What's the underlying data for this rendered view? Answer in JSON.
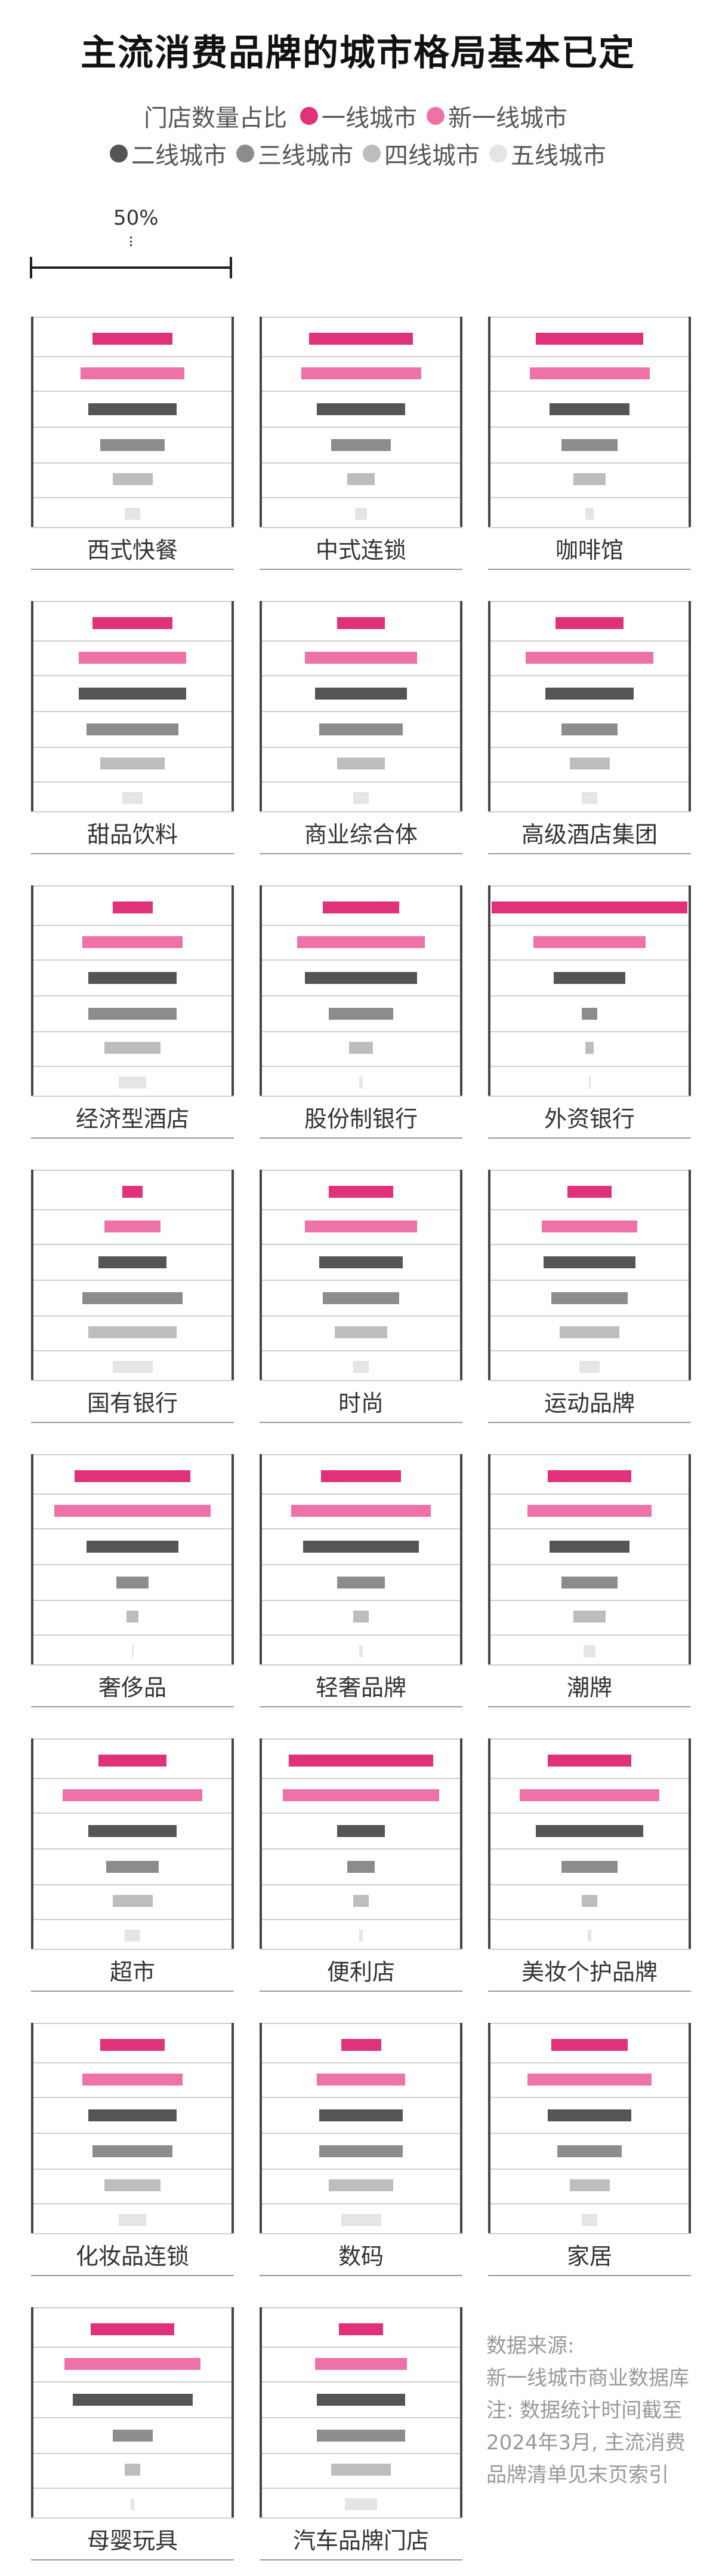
{
  "title": "主流消费品牌的城市格局基本已定",
  "legend": {
    "label": "门店数量占比",
    "tiers": [
      {
        "name": "一线城市",
        "color": "#e0317a"
      },
      {
        "name": "新一线城市",
        "color": "#ee72a8"
      },
      {
        "name": "二线城市",
        "color": "#555555"
      },
      {
        "name": "三线城市",
        "color": "#8c8c8c"
      },
      {
        "name": "四线城市",
        "color": "#bdbdbd"
      },
      {
        "name": "五线城市",
        "color": "#e5e5e5"
      }
    ]
  },
  "scale": {
    "label": "50%",
    "value": 50
  },
  "chart_data": {
    "type": "bar",
    "orientation": "horizontal",
    "unit": "%",
    "series_names": [
      "一线城市",
      "新一线城市",
      "二线城市",
      "三线城市",
      "四线城市",
      "五线城市"
    ],
    "panels": [
      {
        "name": "西式快餐",
        "values": [
          20,
          26,
          22,
          16,
          10,
          4
        ]
      },
      {
        "name": "中式连锁",
        "values": [
          26,
          30,
          22,
          15,
          7,
          3
        ]
      },
      {
        "name": "咖啡馆",
        "values": [
          27,
          30,
          20,
          14,
          8,
          2
        ]
      },
      {
        "name": "甜品饮料",
        "values": [
          20,
          27,
          27,
          23,
          16,
          5
        ]
      },
      {
        "name": "商业综合体",
        "values": [
          12,
          28,
          23,
          21,
          12,
          4
        ]
      },
      {
        "name": "高级酒店集团",
        "values": [
          17,
          32,
          22,
          14,
          10,
          4
        ]
      },
      {
        "name": "经济型酒店",
        "values": [
          10,
          25,
          22,
          22,
          14,
          7
        ]
      },
      {
        "name": "股份制银行",
        "values": [
          19,
          32,
          28,
          16,
          6,
          1
        ]
      },
      {
        "name": "外资银行",
        "values": [
          49,
          28,
          18,
          4,
          2,
          0
        ]
      },
      {
        "name": "国有银行",
        "values": [
          5,
          14,
          17,
          25,
          22,
          10
        ]
      },
      {
        "name": "时尚",
        "values": [
          16,
          28,
          21,
          19,
          13,
          4
        ]
      },
      {
        "name": "运动品牌",
        "values": [
          11,
          24,
          23,
          19,
          15,
          5
        ]
      },
      {
        "name": "奢侈品",
        "values": [
          29,
          39,
          23,
          8,
          3,
          0
        ]
      },
      {
        "name": "轻奢品牌",
        "values": [
          20,
          35,
          29,
          12,
          4,
          1
        ]
      },
      {
        "name": "潮牌",
        "values": [
          21,
          31,
          20,
          14,
          8,
          3
        ]
      },
      {
        "name": "超市",
        "values": [
          17,
          35,
          22,
          13,
          10,
          4
        ]
      },
      {
        "name": "便利店",
        "values": [
          36,
          39,
          12,
          7,
          4,
          1
        ]
      },
      {
        "name": "美妆个护品牌",
        "values": [
          21,
          35,
          27,
          14,
          4,
          1
        ]
      },
      {
        "name": "化妆品连锁",
        "values": [
          16,
          25,
          22,
          20,
          14,
          7
        ]
      },
      {
        "name": "数码",
        "values": [
          10,
          22,
          21,
          21,
          16,
          10
        ]
      },
      {
        "name": "家居",
        "values": [
          19,
          31,
          21,
          16,
          10,
          4
        ]
      },
      {
        "name": "母婴玩具",
        "values": [
          21,
          34,
          30,
          10,
          4,
          1
        ]
      },
      {
        "name": "汽车品牌门店",
        "values": [
          11,
          23,
          22,
          22,
          15,
          8
        ]
      }
    ]
  },
  "note": {
    "lines": [
      "数据来源:",
      "新一线城市商业数据库",
      "注: 数据统计时间截至",
      "2024年3月, 主流消费",
      "品牌清单见末页索引"
    ]
  }
}
